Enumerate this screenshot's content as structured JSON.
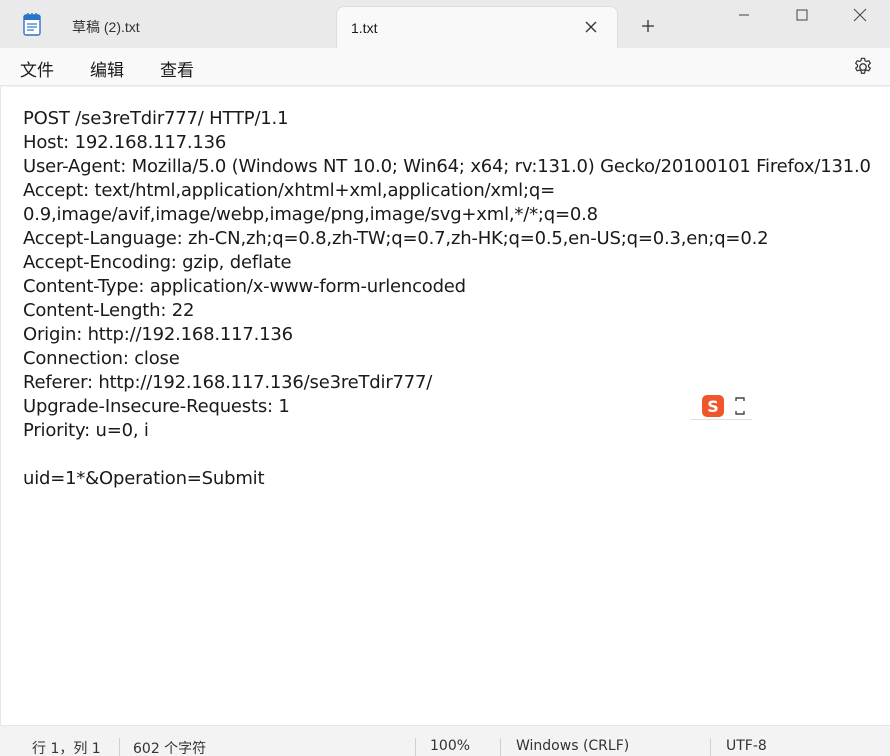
{
  "tabs": [
    {
      "label": "草稿 (2).txt",
      "active": false
    },
    {
      "label": "1.txt",
      "active": true
    }
  ],
  "menu": [
    "文件",
    "编辑",
    "查看"
  ],
  "editor": {
    "lines": [
      "POST /se3reTdir777/ HTTP/1.1",
      "Host: 192.168.117.136",
      "User-Agent: Mozilla/5.0 (Windows NT 10.0; Win64; x64; rv:131.0) Gecko/20100101 Firefox/131.0",
      "Accept: text/html,application/xhtml+xml,application/xml;q=",
      "0.9,image/avif,image/webp,image/png,image/svg+xml,*/*;q=0.8",
      "Accept-Language: zh-CN,zh;q=0.8,zh-TW;q=0.7,zh-HK;q=0.5,en-US;q=0.3,en;q=0.2",
      "Accept-Encoding: gzip, deflate",
      "Content-Type: application/x-www-form-urlencoded",
      "Content-Length: 22",
      "Origin: http://192.168.117.136",
      "Connection: close",
      "Referer: http://192.168.117.136/se3reTdir777/",
      "Upgrade-Insecure-Requests: 1",
      "Priority: u=0, i",
      "",
      "uid=1*&Operation=Submit"
    ]
  },
  "ime": {
    "logo": "S"
  },
  "status": {
    "position": "行 1，列 1",
    "chars": "602 个字符",
    "zoom": "100%",
    "line_ending": "Windows (CRLF)",
    "encoding": "UTF-8"
  },
  "colors": {
    "accent": "#1a1a1a",
    "ime": "#f0562b"
  },
  "icons": {
    "app": "notepad-icon",
    "close_tab": "close-icon",
    "new_tab": "plus-icon",
    "settings": "gear-icon",
    "minimize": "minimize-icon",
    "maximize": "maximize-icon",
    "close_window": "close-window-icon"
  }
}
